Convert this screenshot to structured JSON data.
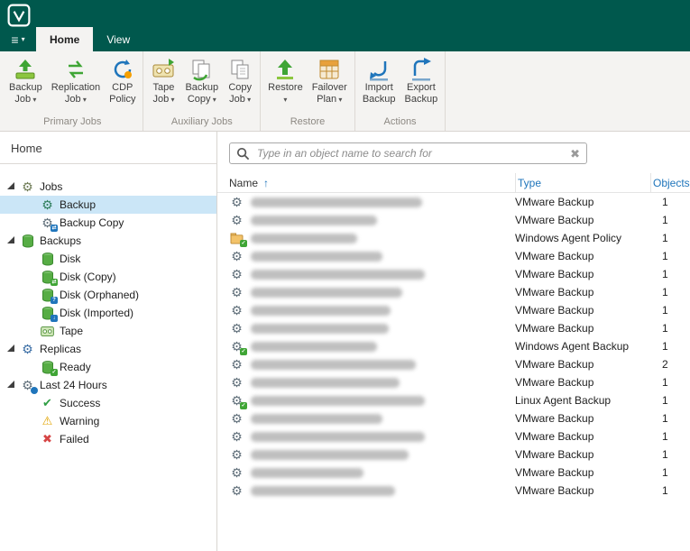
{
  "header": {
    "menu_icon": "≡",
    "menu_caret": "▾",
    "tabs": [
      "Home",
      "View"
    ],
    "brand_color": "#00584d"
  },
  "ribbon": {
    "groups": [
      {
        "label": "Primary Jobs",
        "buttons": [
          {
            "lines": [
              "Backup",
              "Job"
            ],
            "dropdown": true,
            "icon": "backup-job-icon"
          },
          {
            "lines": [
              "Replication",
              "Job"
            ],
            "dropdown": true,
            "icon": "replication-job-icon"
          },
          {
            "lines": [
              "CDP",
              "Policy"
            ],
            "dropdown": false,
            "icon": "cdp-policy-icon"
          }
        ]
      },
      {
        "label": "Auxiliary Jobs",
        "buttons": [
          {
            "lines": [
              "Tape",
              "Job"
            ],
            "dropdown": true,
            "icon": "tape-job-icon"
          },
          {
            "lines": [
              "Backup",
              "Copy"
            ],
            "dropdown": true,
            "icon": "backup-copy-icon"
          },
          {
            "lines": [
              "Copy",
              "Job"
            ],
            "dropdown": true,
            "icon": "copy-job-icon"
          }
        ]
      },
      {
        "label": "Restore",
        "buttons": [
          {
            "lines": [
              "Restore"
            ],
            "dropdown": true,
            "icon": "restore-icon"
          },
          {
            "lines": [
              "Failover",
              "Plan"
            ],
            "dropdown": true,
            "icon": "failover-plan-icon"
          }
        ]
      },
      {
        "label": "Actions",
        "buttons": [
          {
            "lines": [
              "Import",
              "Backup"
            ],
            "dropdown": false,
            "icon": "import-backup-icon"
          },
          {
            "lines": [
              "Export",
              "Backup"
            ],
            "dropdown": false,
            "icon": "export-backup-icon"
          }
        ]
      }
    ]
  },
  "sidebar": {
    "title": "Home",
    "tree": [
      {
        "label": "Jobs",
        "icon": "jobs-gear-icon",
        "level": 0,
        "expanded": true,
        "selected": false
      },
      {
        "label": "Backup",
        "icon": "backup-gear-icon",
        "level": 1,
        "selected": true
      },
      {
        "label": "Backup Copy",
        "icon": "backup-copy-gear-icon",
        "level": 1,
        "selected": false
      },
      {
        "label": "Backups",
        "icon": "backups-disk-icon",
        "level": 0,
        "expanded": true,
        "selected": false
      },
      {
        "label": "Disk",
        "icon": "disk-icon",
        "level": 1,
        "selected": false
      },
      {
        "label": "Disk (Copy)",
        "icon": "disk-copy-icon",
        "level": 1,
        "selected": false
      },
      {
        "label": "Disk (Orphaned)",
        "icon": "disk-orphaned-icon",
        "level": 1,
        "selected": false
      },
      {
        "label": "Disk (Imported)",
        "icon": "disk-imported-icon",
        "level": 1,
        "selected": false
      },
      {
        "label": "Tape",
        "icon": "tape-icon",
        "level": 1,
        "selected": false
      },
      {
        "label": "Replicas",
        "icon": "replicas-gear-icon",
        "level": 0,
        "expanded": true,
        "selected": false
      },
      {
        "label": "Ready",
        "icon": "ready-icon",
        "level": 1,
        "selected": false
      },
      {
        "label": "Last 24 Hours",
        "icon": "last-24-hours-icon",
        "level": 0,
        "expanded": true,
        "selected": false
      },
      {
        "label": "Success",
        "icon": "success-icon",
        "level": 1,
        "selected": false
      },
      {
        "label": "Warning",
        "icon": "warning-icon",
        "level": 1,
        "selected": false
      },
      {
        "label": "Failed",
        "icon": "failed-icon",
        "level": 1,
        "selected": false
      }
    ]
  },
  "search": {
    "placeholder": "Type in an object name to search for",
    "clear_icon": "✖"
  },
  "table": {
    "columns": [
      "Name",
      "Type",
      "Objects"
    ],
    "sort": {
      "column": "Name",
      "direction": "ascending"
    },
    "sort_indicator": "↑",
    "rows": [
      {
        "icon": "gear-icon",
        "name_redacted": true,
        "blur_w": 190,
        "type": "VMware Backup",
        "objects": 1
      },
      {
        "icon": "gear-icon",
        "name_redacted": true,
        "blur_w": 140,
        "type": "VMware Backup",
        "objects": 1
      },
      {
        "icon": "policy-icon",
        "name_redacted": true,
        "blur_w": 118,
        "type": "Windows Agent Policy",
        "objects": 1
      },
      {
        "icon": "gear-icon",
        "name_redacted": true,
        "blur_w": 146,
        "type": "VMware Backup",
        "objects": 1
      },
      {
        "icon": "gear-icon",
        "name_redacted": true,
        "blur_w": 193,
        "type": "VMware Backup",
        "objects": 1
      },
      {
        "icon": "gear-icon",
        "name_redacted": true,
        "blur_w": 168,
        "type": "VMware Backup",
        "objects": 1
      },
      {
        "icon": "gear-icon",
        "name_redacted": true,
        "blur_w": 155,
        "type": "VMware Backup",
        "objects": 1
      },
      {
        "icon": "gear-icon",
        "name_redacted": true,
        "blur_w": 153,
        "type": "VMware Backup",
        "objects": 1
      },
      {
        "icon": "agent-gear-icon",
        "name_redacted": true,
        "blur_w": 140,
        "type": "Windows Agent Backup",
        "objects": 1
      },
      {
        "icon": "gear-icon",
        "name_redacted": true,
        "blur_w": 183,
        "type": "VMware Backup",
        "objects": 2
      },
      {
        "icon": "gear-icon",
        "name_redacted": true,
        "blur_w": 165,
        "type": "VMware Backup",
        "objects": 1
      },
      {
        "icon": "agent-gear-icon",
        "name_redacted": true,
        "blur_w": 193,
        "type": "Linux Agent Backup",
        "objects": 1
      },
      {
        "icon": "gear-icon",
        "name_redacted": true,
        "blur_w": 146,
        "type": "VMware Backup",
        "objects": 1
      },
      {
        "icon": "gear-icon",
        "name_redacted": true,
        "blur_w": 193,
        "type": "VMware Backup",
        "objects": 1
      },
      {
        "icon": "gear-icon",
        "name_redacted": true,
        "blur_w": 175,
        "type": "VMware Backup",
        "objects": 1
      },
      {
        "icon": "gear-icon",
        "name_redacted": true,
        "blur_w": 125,
        "type": "VMware Backup",
        "objects": 1
      },
      {
        "icon": "gear-icon",
        "name_redacted": true,
        "blur_w": 160,
        "type": "VMware Backup",
        "objects": 1
      }
    ]
  }
}
